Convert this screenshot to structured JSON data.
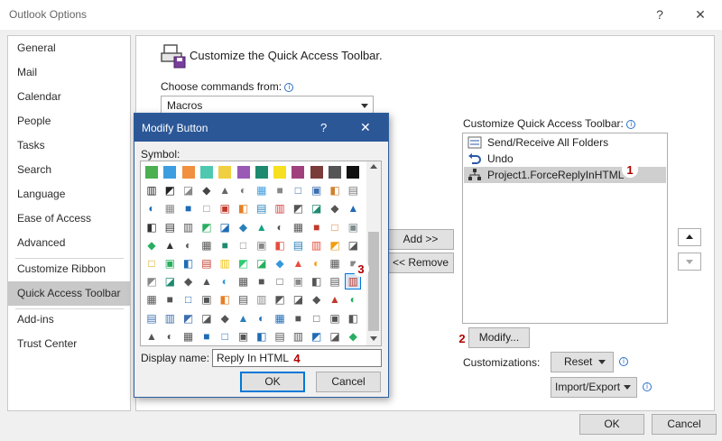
{
  "window": {
    "title": "Outlook Options",
    "help": "?",
    "close": "✕"
  },
  "nav": {
    "items": [
      "General",
      "Mail",
      "Calendar",
      "People",
      "Tasks",
      "Search",
      "Language",
      "Ease of Access",
      "Advanced",
      "Customize Ribbon",
      "Quick Access Toolbar",
      "Add-ins",
      "Trust Center"
    ],
    "selected": "Quick Access Toolbar"
  },
  "main": {
    "header": "Customize the Quick Access Toolbar.",
    "choose_label": "Choose commands from:",
    "choose_value": "Macros",
    "customize_label": "Customize Quick Access Toolbar:",
    "qat_items": [
      {
        "icon": "send-receive-icon",
        "label": "Send/Receive All Folders"
      },
      {
        "icon": "undo-icon",
        "label": "Undo"
      },
      {
        "icon": "macro-icon",
        "label": "Project1.ForceReplyInHTML"
      }
    ],
    "add_button": "Add >>",
    "remove_button": "<< Remove",
    "modify_button": "Modify...",
    "customizations_label": "Customizations:",
    "reset_button": "Reset",
    "import_export_button": "Import/Export",
    "ok_button": "OK",
    "cancel_button": "Cancel"
  },
  "modal": {
    "title": "Modify Button",
    "help": "?",
    "close": "✕",
    "symbol_label": "Symbol:",
    "display_name_label": "Display name:",
    "display_name_value": "Reply In HTML",
    "ok_button": "OK",
    "cancel_button": "Cancel"
  },
  "badges": [
    "1",
    "2",
    "3",
    "4"
  ],
  "colors": {
    "selected_nav": "#c8c8c8",
    "modal_title": "#2b5797",
    "primary_border": "#0078d7",
    "badge_text": "#b00000"
  }
}
